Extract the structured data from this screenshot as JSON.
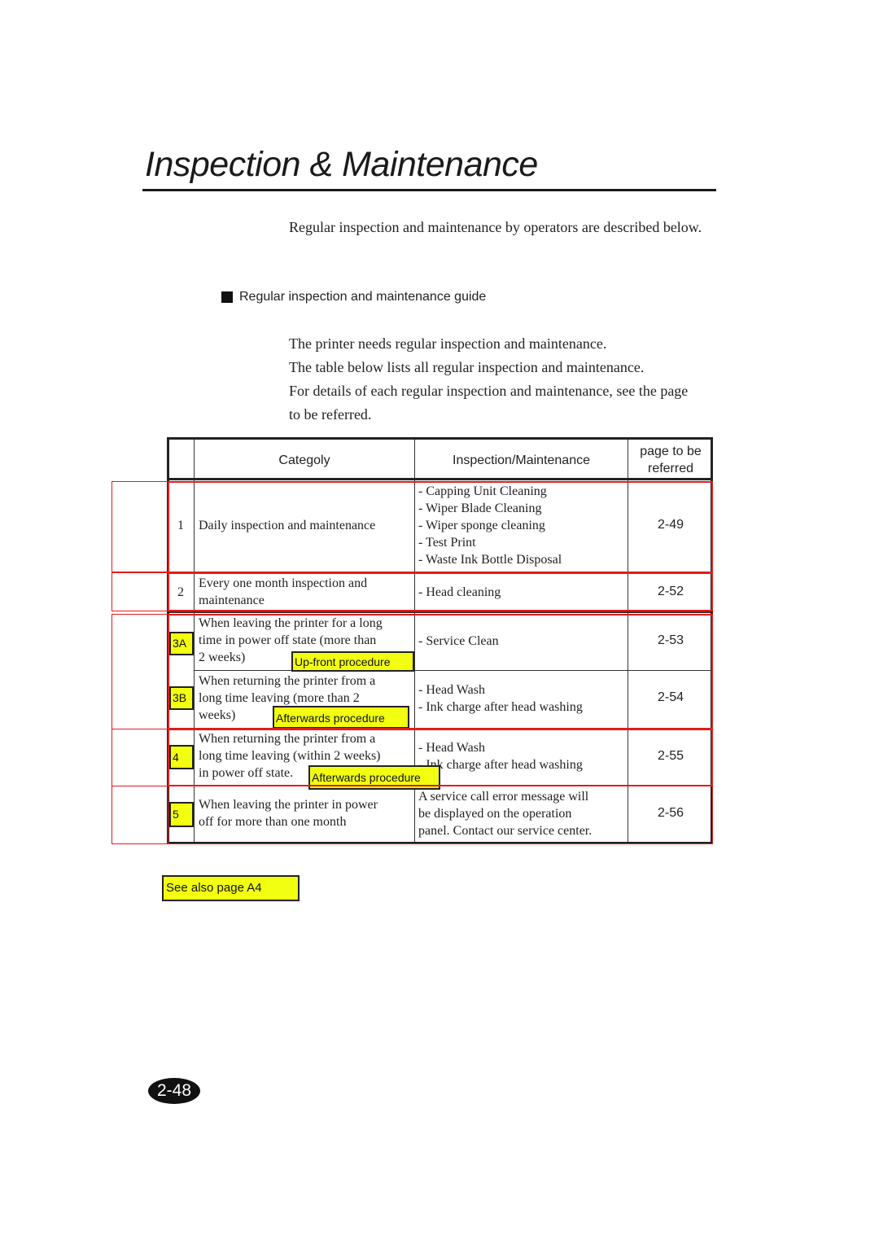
{
  "page": {
    "title": "Inspection & Maintenance",
    "intro": "Regular inspection and maintenance by operators are described below.",
    "section_heading": "Regular inspection and maintenance guide",
    "body_lines": [
      "The printer needs regular inspection and maintenance.",
      "The table below lists all regular inspection and maintenance.",
      "For details of each regular inspection and maintenance, see the page",
      "to be referred."
    ],
    "see_also": "See also page A4",
    "page_number": "2-48"
  },
  "table": {
    "headers": {
      "category": "Categoly",
      "inspection": "Inspection/Maintenance",
      "page_line1": "page to be",
      "page_line2": "referred"
    },
    "rows": [
      {
        "no": "1",
        "category": "Daily inspection and maintenance",
        "items": [
          "- Capping Unit Cleaning",
          "- Wiper Blade Cleaning",
          "- Wiper sponge cleaning",
          "- Test Print",
          "- Waste Ink Bottle Disposal"
        ],
        "page": "2-49"
      },
      {
        "no": "2",
        "category_lines": [
          "Every one month inspection and",
          "maintenance"
        ],
        "items": [
          "- Head cleaning"
        ],
        "page": "2-52"
      },
      {
        "no": "3A",
        "category_lines": [
          "When leaving the printer for a long",
          "time in power off state (more than",
          "2 weeks)"
        ],
        "items": [
          "- Service Clean"
        ],
        "page": "2-53",
        "note": "Up-front procedure"
      },
      {
        "no": "3B",
        "category_lines": [
          "When returning the printer from a",
          "long time leaving (more than 2",
          "weeks)"
        ],
        "items": [
          "- Head Wash",
          "- Ink charge after head washing"
        ],
        "page": "2-54",
        "note": "Afterwards procedure"
      },
      {
        "no": "4",
        "category_lines": [
          "When returning the printer from a",
          "long time leaving (within 2 weeks)",
          "in power off state."
        ],
        "items": [
          "- Head Wash",
          "- Ink charge after head washing"
        ],
        "page": "2-55",
        "note": "Afterwards procedure"
      },
      {
        "no": "5",
        "category_lines": [
          "When leaving the printer in power",
          "off for more than one month"
        ],
        "items": [
          "A service call error message will",
          "be displayed on the operation",
          "panel.  Contact our service center."
        ],
        "page": "2-56"
      }
    ]
  },
  "colors": {
    "highlight_yellow": "#f3ff10",
    "annotation_red": "#e41b1b",
    "text": "#1a1a1a"
  }
}
